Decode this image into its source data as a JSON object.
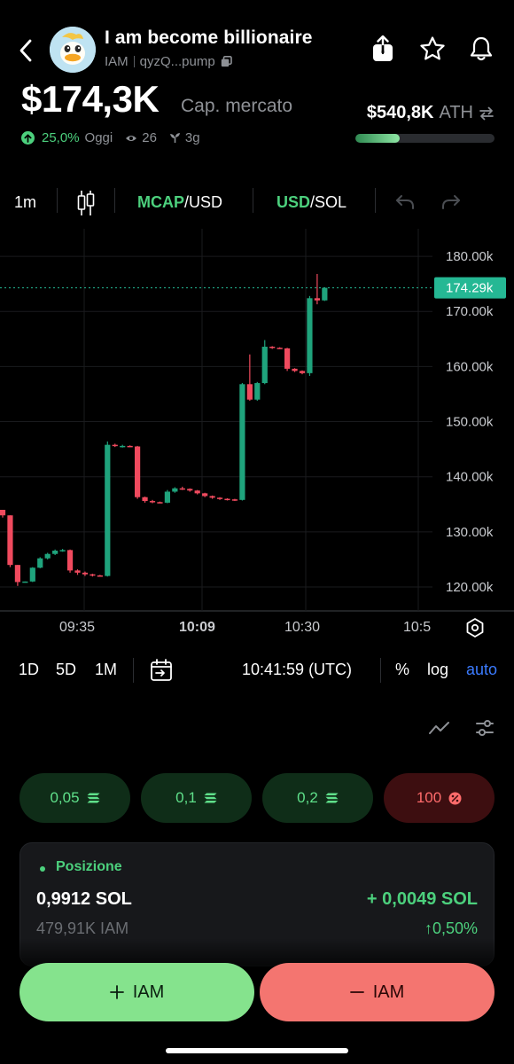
{
  "header": {
    "token_name": "I am become billionaire",
    "ticker": "IAM",
    "address": "qyzQ...pump"
  },
  "market": {
    "mcap_value": "$174,3K",
    "mcap_label": "Cap. mercato",
    "ath_value": "$540,8K",
    "ath_label": "ATH",
    "ath_progress": 0.32,
    "change_pct": "25,0%",
    "change_period": "Oggi",
    "views": "26",
    "age": "3g"
  },
  "toolbar": {
    "interval": "1m",
    "mcap_active": "MCAP",
    "mcap_rest": "/USD",
    "usd_active": "USD",
    "usd_rest": "/SOL"
  },
  "chart_data": {
    "type": "candlestick",
    "y_ticks": [
      "180.00k",
      "170.00k",
      "160.00k",
      "150.00k",
      "140.00k",
      "130.00k",
      "120.00k"
    ],
    "ylim": [
      115.5,
      185.0
    ],
    "current_price_label": "174.29k",
    "current_price": 174.29,
    "x_ticks": [
      "09:35",
      "10:09",
      "10:30",
      "10:5"
    ],
    "colors": {
      "up": "#1fa37c",
      "down": "#f04a5e",
      "price_line": "#25b894"
    },
    "candles": [
      {
        "o": 134.0,
        "h": 134.0,
        "l": 132.6,
        "c": 133.0
      },
      {
        "o": 133.0,
        "h": 133.0,
        "l": 123.6,
        "c": 124.0
      },
      {
        "o": 124.0,
        "h": 124.0,
        "l": 120.2,
        "c": 120.9
      },
      {
        "o": 120.9,
        "h": 121.0,
        "l": 120.8,
        "c": 121.0
      },
      {
        "o": 121.0,
        "h": 123.6,
        "l": 120.9,
        "c": 123.5
      },
      {
        "o": 123.5,
        "h": 125.4,
        "l": 123.4,
        "c": 125.2
      },
      {
        "o": 125.2,
        "h": 126.2,
        "l": 125.0,
        "c": 126.0
      },
      {
        "o": 126.0,
        "h": 126.8,
        "l": 125.8,
        "c": 126.6
      },
      {
        "o": 126.6,
        "h": 126.9,
        "l": 126.4,
        "c": 126.7
      },
      {
        "o": 126.7,
        "h": 126.8,
        "l": 122.6,
        "c": 123.0
      },
      {
        "o": 123.0,
        "h": 123.2,
        "l": 122.2,
        "c": 122.6
      },
      {
        "o": 122.6,
        "h": 122.8,
        "l": 122.0,
        "c": 122.3
      },
      {
        "o": 122.3,
        "h": 122.4,
        "l": 121.9,
        "c": 122.1
      },
      {
        "o": 122.1,
        "h": 122.2,
        "l": 121.9,
        "c": 122.0
      },
      {
        "o": 122.0,
        "h": 146.4,
        "l": 121.9,
        "c": 145.8
      },
      {
        "o": 145.8,
        "h": 146.0,
        "l": 145.4,
        "c": 145.6
      },
      {
        "o": 145.6,
        "h": 145.8,
        "l": 145.3,
        "c": 145.6
      },
      {
        "o": 145.6,
        "h": 145.7,
        "l": 145.4,
        "c": 145.5
      },
      {
        "o": 145.5,
        "h": 145.6,
        "l": 136.0,
        "c": 136.3
      },
      {
        "o": 136.3,
        "h": 136.4,
        "l": 135.3,
        "c": 135.6
      },
      {
        "o": 135.6,
        "h": 135.8,
        "l": 135.2,
        "c": 135.4
      },
      {
        "o": 135.4,
        "h": 135.5,
        "l": 135.2,
        "c": 135.3
      },
      {
        "o": 135.3,
        "h": 137.6,
        "l": 135.2,
        "c": 137.3
      },
      {
        "o": 137.3,
        "h": 138.1,
        "l": 137.1,
        "c": 137.9
      },
      {
        "o": 137.9,
        "h": 138.2,
        "l": 137.6,
        "c": 137.8
      },
      {
        "o": 137.8,
        "h": 137.9,
        "l": 137.3,
        "c": 137.5
      },
      {
        "o": 137.5,
        "h": 137.6,
        "l": 136.8,
        "c": 137.0
      },
      {
        "o": 137.0,
        "h": 137.1,
        "l": 136.3,
        "c": 136.5
      },
      {
        "o": 136.5,
        "h": 136.6,
        "l": 136.0,
        "c": 136.2
      },
      {
        "o": 136.2,
        "h": 136.3,
        "l": 135.8,
        "c": 136.0
      },
      {
        "o": 136.0,
        "h": 136.1,
        "l": 135.7,
        "c": 135.9
      },
      {
        "o": 135.9,
        "h": 136.0,
        "l": 135.6,
        "c": 135.8
      },
      {
        "o": 135.8,
        "h": 157.0,
        "l": 135.7,
        "c": 156.8
      },
      {
        "o": 156.8,
        "h": 162.2,
        "l": 153.8,
        "c": 154.0
      },
      {
        "o": 154.0,
        "h": 157.2,
        "l": 153.8,
        "c": 157.0
      },
      {
        "o": 157.0,
        "h": 164.8,
        "l": 156.8,
        "c": 163.6
      },
      {
        "o": 163.6,
        "h": 163.7,
        "l": 163.2,
        "c": 163.4
      },
      {
        "o": 163.4,
        "h": 163.5,
        "l": 163.2,
        "c": 163.3
      },
      {
        "o": 163.3,
        "h": 163.4,
        "l": 159.2,
        "c": 159.6
      },
      {
        "o": 159.6,
        "h": 159.7,
        "l": 159.0,
        "c": 159.2
      },
      {
        "o": 159.2,
        "h": 159.3,
        "l": 158.6,
        "c": 158.8
      },
      {
        "o": 158.8,
        "h": 172.8,
        "l": 158.3,
        "c": 172.4
      },
      {
        "o": 172.4,
        "h": 176.8,
        "l": 171.3,
        "c": 172.0
      },
      {
        "o": 172.0,
        "h": 174.3,
        "l": 171.9,
        "c": 174.29
      }
    ]
  },
  "range": {
    "r1": "1D",
    "r2": "5D",
    "r3": "1M",
    "time": "10:41:59 (UTC)",
    "pct": "%",
    "log": "log",
    "auto": "auto"
  },
  "presets": [
    "0,05",
    "0,1",
    "0,2",
    "100"
  ],
  "position": {
    "label": "Posizione",
    "sol_amount": "0,9912 SOL",
    "token_amount": "479,91K IAM",
    "pnl_sol": "+ 0,0049 SOL",
    "pnl_pct": "↑0,50%"
  },
  "actions": {
    "buy_label": "IAM",
    "sell_label": "IAM"
  }
}
